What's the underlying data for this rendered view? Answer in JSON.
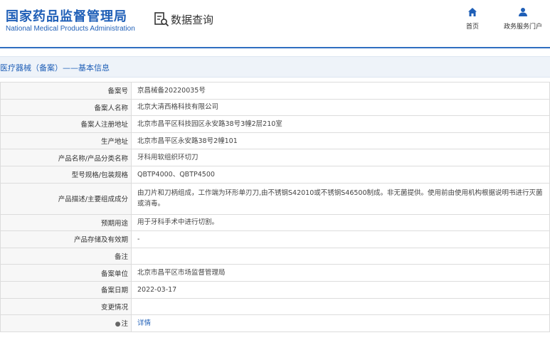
{
  "header": {
    "logo_cn": "国家药品监督管理局",
    "logo_en": "National Medical Products Administration",
    "query_label": "数据查询",
    "nav": [
      {
        "label": "首页",
        "icon": "home-icon"
      },
      {
        "label": "政务服务门户",
        "icon": "user-icon"
      }
    ]
  },
  "section": {
    "title": "医疗器械（备案）——基本信息"
  },
  "rows": [
    {
      "label": "备案号",
      "value": "京昌械备20220035号"
    },
    {
      "label": "备案人名称",
      "value": "北京大清西格科技有限公司"
    },
    {
      "label": "备案人注册地址",
      "value": "北京市昌平区科技园区永安路38号3幢2层210室"
    },
    {
      "label": "生产地址",
      "value": "北京市昌平区永安路38号2幢101"
    },
    {
      "label": "产品名称/产品分类名称",
      "value": "牙科用软组织环切刀"
    },
    {
      "label": "型号规格/包装规格",
      "value": "QBTP4000、QBTP4500"
    },
    {
      "label": "产品描述/主要组成成分",
      "value": "由刀片和刀柄组成，工作端为环形单刃刀,由不锈钢S42010或不锈钢S46500制成。非无菌提供。使用前由使用机构根据说明书进行灭菌或消毒。"
    },
    {
      "label": "预期用途",
      "value": "用于牙科手术中进行切割。"
    },
    {
      "label": "产品存储及有效期",
      "value": "-"
    },
    {
      "label": "备注",
      "value": ""
    },
    {
      "label": "备案单位",
      "value": "北京市昌平区市场监督管理局"
    },
    {
      "label": "备案日期",
      "value": "2022-03-17"
    },
    {
      "label": "变更情况",
      "value": ""
    },
    {
      "label": "注",
      "value": "详情",
      "icon": "pin-icon"
    }
  ],
  "colors": {
    "brand": "#1f5fb7",
    "header_line": "#2f6ec0",
    "label_bg": "#f7f7f7",
    "border": "#dcdcdc"
  }
}
